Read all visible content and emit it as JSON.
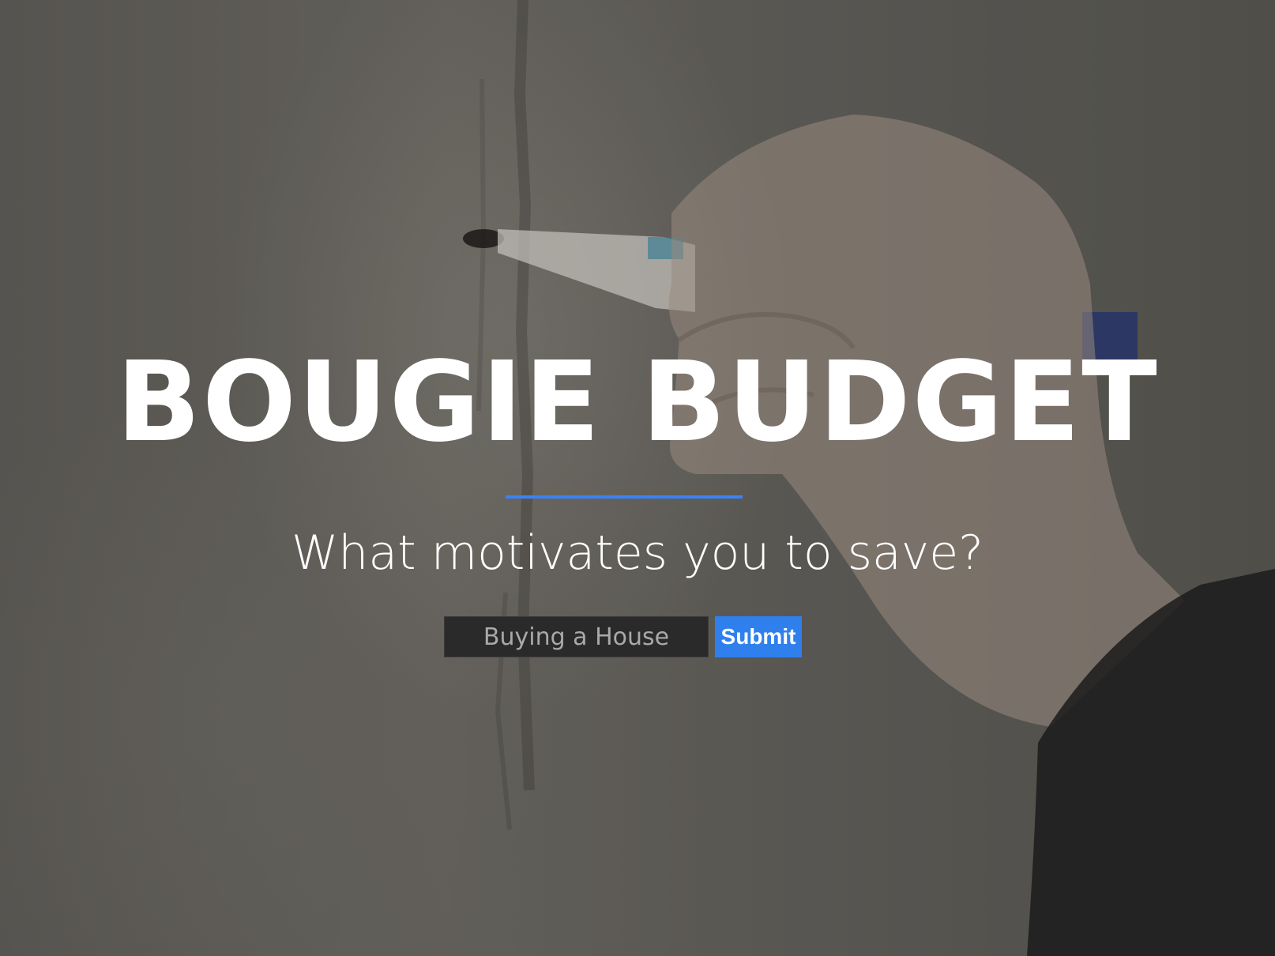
{
  "hero": {
    "title": "BOUGIE BUDGET",
    "subtitle": "What motivates you to save?"
  },
  "form": {
    "input_placeholder": "Buying a House",
    "submit_label": "Submit"
  },
  "colors": {
    "accent": "#2f80ed",
    "divider": "#3b82f6",
    "input_background": "#2a2a2a",
    "text": "#ffffff"
  }
}
